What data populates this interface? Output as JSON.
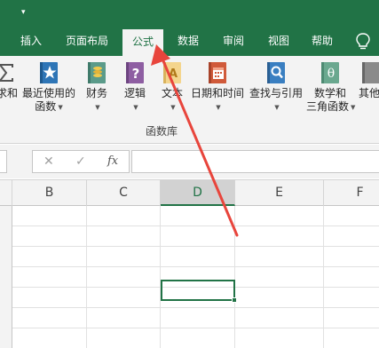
{
  "quick_access": {
    "dropdown_glyph": "▾"
  },
  "tabs": [
    {
      "label": "插入"
    },
    {
      "label": "页面布局"
    },
    {
      "label": "公式",
      "active": true
    },
    {
      "label": "数据"
    },
    {
      "label": "审阅"
    },
    {
      "label": "视图"
    },
    {
      "label": "帮助"
    }
  ],
  "help_icon": "lightbulb-icon",
  "ribbon": {
    "buttons": [
      {
        "line1": "求和",
        "line2": "",
        "icon": "autosum-icon",
        "has_caret": false
      },
      {
        "line1": "最近使用的",
        "line2": "函数",
        "icon": "star-book-icon",
        "has_caret": true
      },
      {
        "line1": "财务",
        "line2": "",
        "icon": "finance-book-icon",
        "has_caret": true
      },
      {
        "line1": "逻辑",
        "line2": "",
        "icon": "question-book-icon",
        "has_caret": true
      },
      {
        "line1": "文本",
        "line2": "",
        "icon": "text-book-icon",
        "has_caret": true
      },
      {
        "line1": "日期和时间",
        "line2": "",
        "icon": "calendar-book-icon",
        "has_caret": true
      },
      {
        "line1": "查找与引用",
        "line2": "",
        "icon": "lookup-book-icon",
        "has_caret": true
      },
      {
        "line1": "数学和",
        "line2": "三角函数",
        "icon": "theta-book-icon",
        "has_caret": true
      },
      {
        "line1": "其他",
        "line2": "",
        "icon": "more-functions-icon",
        "has_caret": false
      }
    ],
    "group_label": "函数库"
  },
  "formula_bar": {
    "cancel_glyph": "✕",
    "enter_glyph": "✓",
    "fx_label": "fx",
    "value": ""
  },
  "columns": [
    "B",
    "C",
    "D",
    "E",
    "F"
  ],
  "selected_column": "D",
  "colors": {
    "excel_green": "#217346",
    "arrow_red": "#e8453c"
  }
}
